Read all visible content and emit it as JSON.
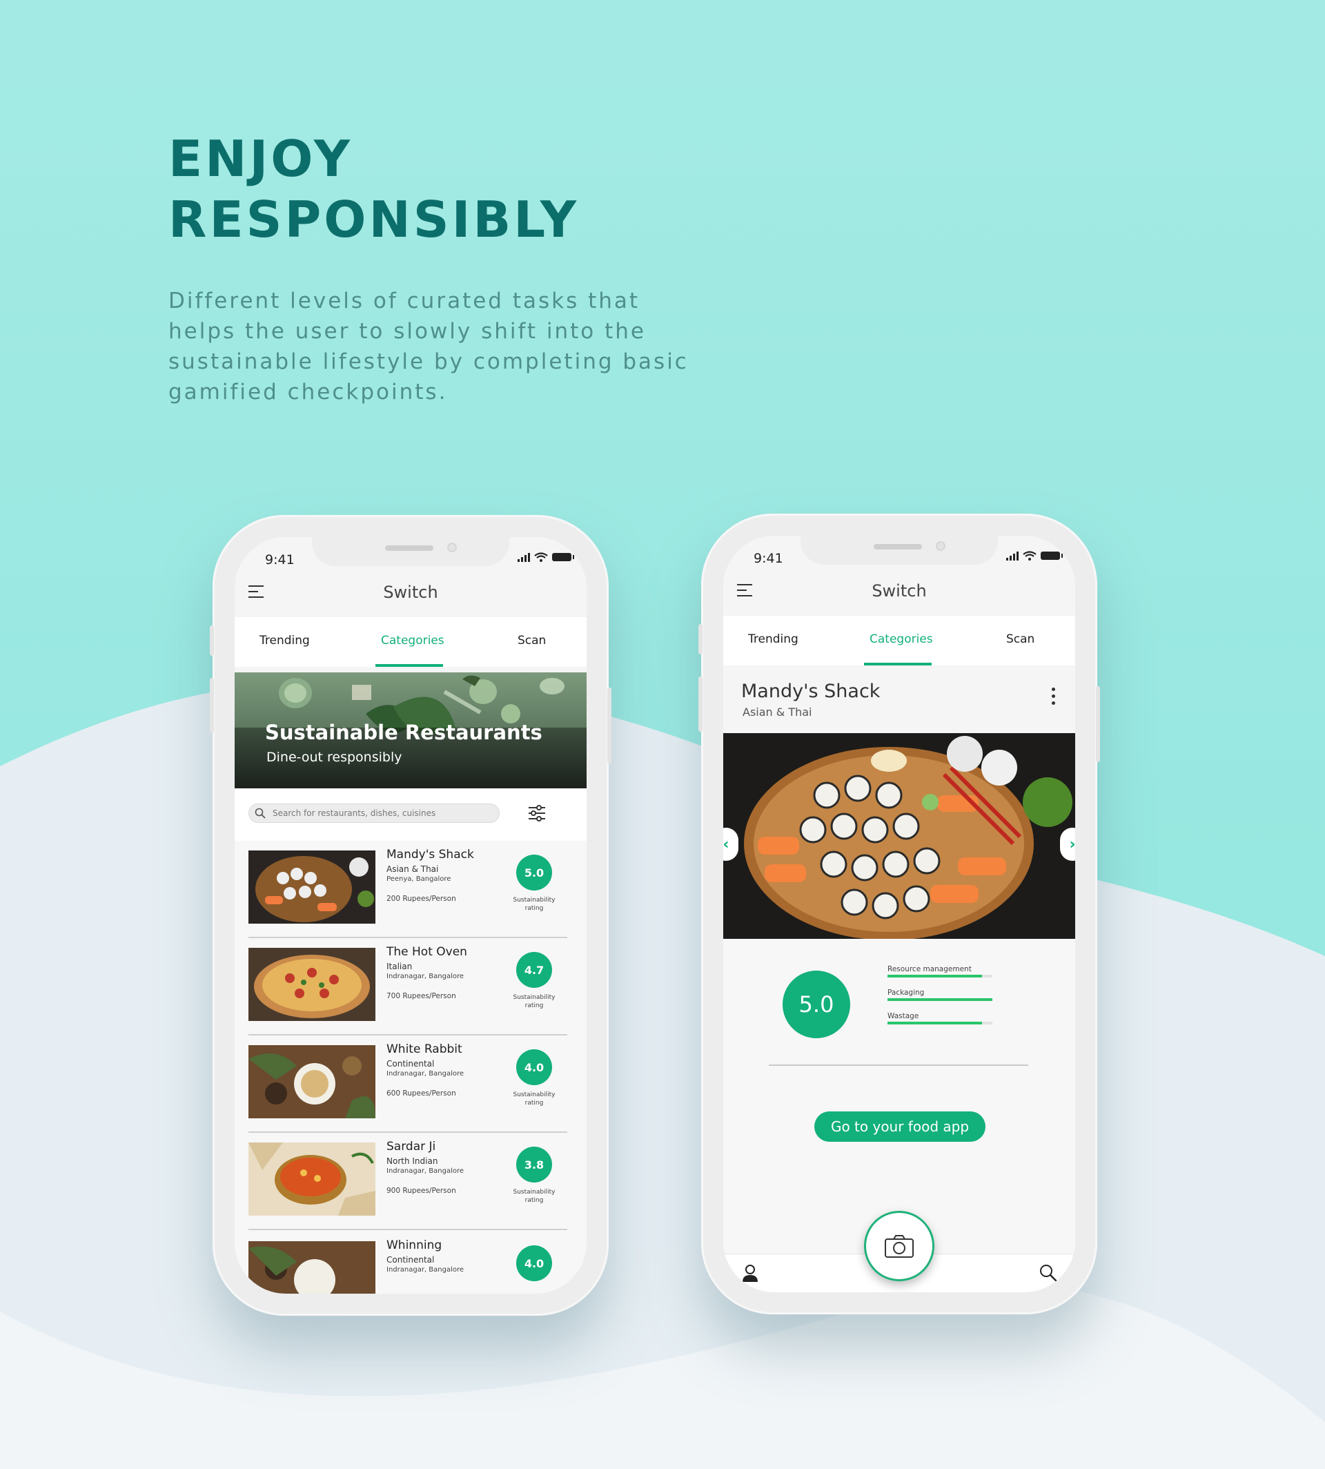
{
  "hero": {
    "title_line1": "ENJOY",
    "title_line2": "RESPONSIBLY",
    "description": "Different levels of curated tasks that helps the user to slowly shift into the sustainable lifestyle by completing basic gamified checkpoints."
  },
  "colors": {
    "accent": "#12b07a",
    "heading": "#0c6e6a",
    "background": "#9fe9e3"
  },
  "phone_left": {
    "status_time": "9:41",
    "app_title": "Switch",
    "tabs": [
      {
        "label": "Trending",
        "active": false
      },
      {
        "label": "Categories",
        "active": true
      },
      {
        "label": "Scan",
        "active": false
      }
    ],
    "banner": {
      "title": "Sustainable Restaurants",
      "subtitle": "Dine-out responsibly"
    },
    "search": {
      "placeholder": "Search for restaurants, dishes, cuisines"
    },
    "restaurants": [
      {
        "name": "Mandy's Shack",
        "cuisine": "Asian & Thai",
        "location": "Peenya, Bangalore",
        "price": "200 Rupees/Person",
        "rating": "5.0",
        "rating_label": "Sustainability rating"
      },
      {
        "name": "The Hot Oven",
        "cuisine": "Italian",
        "location": "Indranagar, Bangalore",
        "price": "700 Rupees/Person",
        "rating": "4.7",
        "rating_label": "Sustainability rating"
      },
      {
        "name": "White Rabbit",
        "cuisine": "Continental",
        "location": "Indranagar, Bangalore",
        "price": "600 Rupees/Person",
        "rating": "4.0",
        "rating_label": "Sustainability rating"
      },
      {
        "name": "Sardar Ji",
        "cuisine": "North Indian",
        "location": "Indranagar, Bangalore",
        "price": "900 Rupees/Person",
        "rating": "3.8",
        "rating_label": "Sustainability rating"
      },
      {
        "name": "Whinning",
        "cuisine": "Continental",
        "location": "Indranagar, Bangalore",
        "price": "",
        "rating": "4.0",
        "rating_label": ""
      }
    ]
  },
  "phone_right": {
    "status_time": "9:41",
    "app_title": "Switch",
    "tabs": [
      {
        "label": "Trending",
        "active": false
      },
      {
        "label": "Categories",
        "active": true
      },
      {
        "label": "Scan",
        "active": false
      }
    ],
    "restaurant": {
      "name": "Mandy's Shack",
      "cuisine": "Asian & Thai"
    },
    "rating": "5.0",
    "metrics": [
      {
        "label": "Resource management",
        "value": 0.9
      },
      {
        "label": "Packaging",
        "value": 1.0
      },
      {
        "label": "Wastage",
        "value": 0.9
      }
    ],
    "cta_label": "Go to your food app",
    "nav_icons": [
      "profile-icon",
      "camera-icon",
      "search-icon"
    ]
  }
}
